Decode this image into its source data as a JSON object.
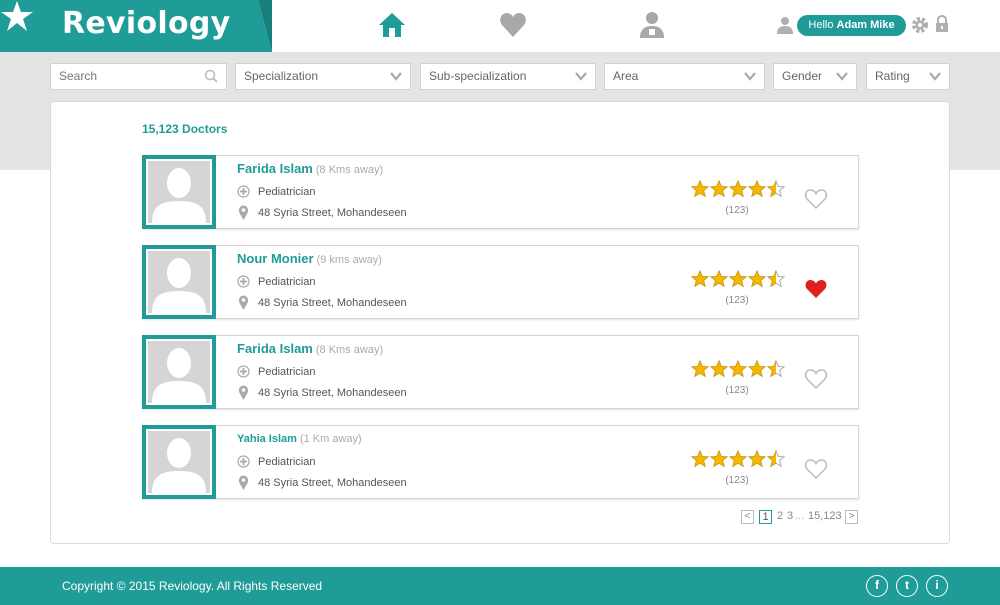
{
  "header": {
    "logo_text": "Reviology",
    "hello_prefix": "Hello",
    "user_name": "Adam Mike",
    "nav": [
      "home-icon",
      "heart-icon",
      "doctor-icon"
    ]
  },
  "colors": {
    "accent": "#1f9c97",
    "band": "#e4e4e4",
    "heart_active": "#e02020",
    "star": "#f5b800"
  },
  "filters": {
    "search_placeholder": "Search",
    "specialization": "Specialization",
    "sub_specialization": "Sub-specialization",
    "area": "Area",
    "gender": "Gender",
    "rating": "Rating"
  },
  "results": {
    "count_label": "15,123 Doctors",
    "doctors": [
      {
        "name": "Farida Islam",
        "distance": "(8 Kms away)",
        "specialty": "Pediatrician",
        "address": "48 Syria Street, Mohandeseen",
        "rating": 4.5,
        "reviews": "(123)",
        "favorite": false
      },
      {
        "name": "Nour Monier",
        "distance": "(9 kms away)",
        "specialty": "Pediatrician",
        "address": "48 Syria Street, Mohandeseen",
        "rating": 4.5,
        "reviews": "(123)",
        "favorite": true
      },
      {
        "name": "Farida Islam",
        "distance": "(8 Kms away)",
        "specialty": "Pediatrician",
        "address": "48 Syria Street, Mohandeseen",
        "rating": 4.5,
        "reviews": "(123)",
        "favorite": false
      },
      {
        "name": "Yahia Islam",
        "distance": "(1 Km away)",
        "specialty": "Pediatrician",
        "address": "48 Syria Street, Mohandeseen",
        "rating": 4.5,
        "reviews": "(123)",
        "favorite": false
      }
    ]
  },
  "pagination": {
    "prev": "<",
    "current": "1",
    "p2": "2",
    "p3": "3",
    "ellipsis": "...",
    "last": "15,123",
    "next": ">"
  },
  "footer": {
    "copyright": "Copyright © 2015 Reviology. All Rights Reserved",
    "social": [
      "f",
      "t",
      "i"
    ]
  }
}
